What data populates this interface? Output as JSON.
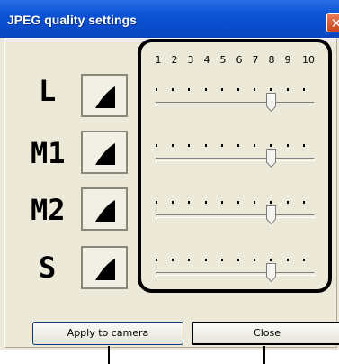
{
  "window": {
    "title": "JPEG quality settings",
    "close_glyph": "✕"
  },
  "scale_labels": [
    "1",
    "2",
    "3",
    "4",
    "5",
    "6",
    "7",
    "8",
    "9",
    "10"
  ],
  "rows": [
    {
      "label": "L",
      "quality": 8,
      "icon": "quality-triangle-icon"
    },
    {
      "label": "M1",
      "quality": 8,
      "icon": "quality-triangle-icon"
    },
    {
      "label": "M2",
      "quality": 8,
      "icon": "quality-triangle-icon"
    },
    {
      "label": "S",
      "quality": 8,
      "icon": "quality-triangle-icon"
    }
  ],
  "buttons": {
    "apply": "Apply to camera",
    "close": "Close"
  },
  "colors": {
    "titlebar": "#0b54d6",
    "dialog_bg": "#ece9d8",
    "highlight_border": "#000000"
  }
}
